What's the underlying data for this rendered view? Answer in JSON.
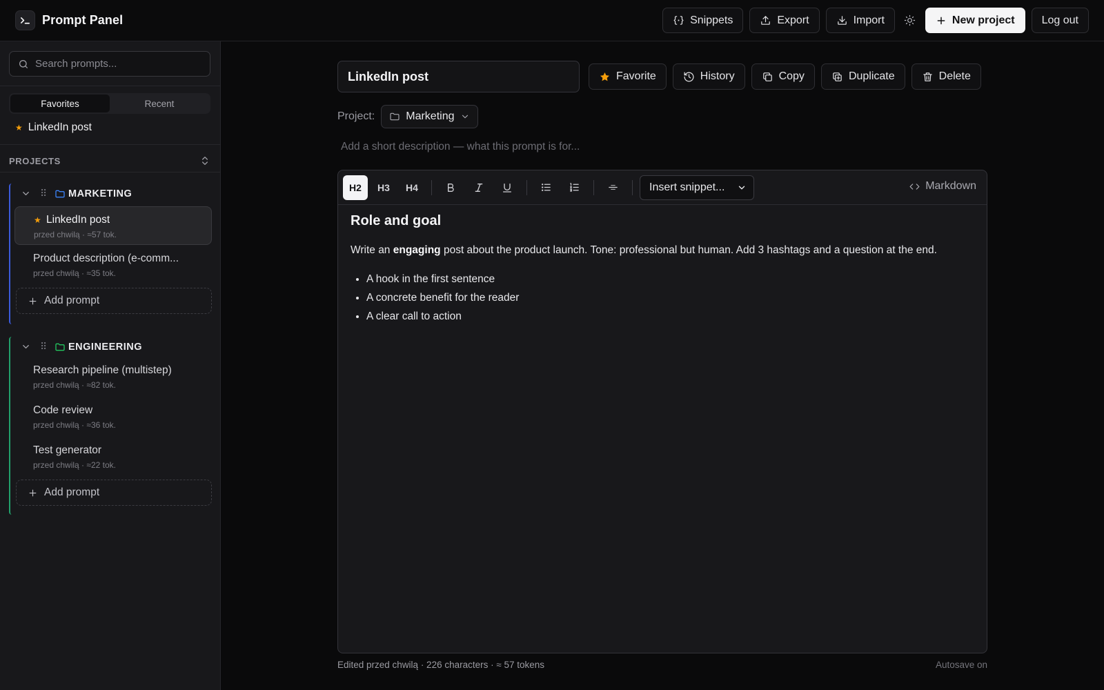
{
  "app": {
    "title": "Prompt Panel"
  },
  "header": {
    "snippets": "Snippets",
    "export": "Export",
    "import": "Import",
    "new_project": "New project",
    "logout": "Log out"
  },
  "sidebar": {
    "search_placeholder": "Search prompts...",
    "tabs": [
      "Favorites",
      "Recent"
    ],
    "active_tab": "Favorites",
    "favorites": [
      {
        "label": "LinkedIn post"
      }
    ],
    "projects_label": "PROJECTS",
    "add_prompt": "Add prompt",
    "projects": [
      {
        "name": "MARKETING",
        "color": "#3b5bdb",
        "items": [
          {
            "title": "LinkedIn post",
            "meta": "przed chwilą · ≈57 tok.",
            "favorite": true,
            "selected": true
          },
          {
            "title": "Product description (e-comm...",
            "meta": "przed chwilą · ≈35 tok.",
            "favorite": false,
            "selected": false
          }
        ]
      },
      {
        "name": "ENGINEERING",
        "color": "#22a06b",
        "items": [
          {
            "title": "Research pipeline (multistep)",
            "meta": "przed chwilą · ≈82 tok."
          },
          {
            "title": "Code review",
            "meta": "przed chwilą · ≈36 tok."
          },
          {
            "title": "Test generator",
            "meta": "przed chwilą · ≈22 tok."
          }
        ]
      }
    ]
  },
  "editor": {
    "title_value": "LinkedIn post",
    "actions": {
      "favorite": "Favorite",
      "history": "History",
      "copy": "Copy",
      "duplicate": "Duplicate",
      "delete": "Delete"
    },
    "project_label": "Project:",
    "project_value": "Marketing",
    "description_placeholder": "Add a short description — what this prompt is for...",
    "toolbar": {
      "h2": "H2",
      "h3": "H3",
      "h4": "H4",
      "active_heading": "H2",
      "snippet_select": "Insert snippet...",
      "markdown": "Markdown"
    },
    "content": {
      "heading": "Role and goal",
      "paragraph_before": "Write an ",
      "paragraph_bold": "engaging",
      "paragraph_after": " post about the product launch. Tone: professional but human. Add 3 hashtags and a question at the end.",
      "bullets": [
        "A hook in the first sentence",
        "A concrete benefit for the reader",
        "A clear call to action"
      ]
    },
    "status": "Edited przed chwilą · 226 characters · ≈ 57 tokens",
    "autosave": "Autosave on"
  },
  "colors": {
    "favorite_star": "#f59e0b",
    "marketing_accent": "#3b5bdb",
    "engineering_accent": "#22a06b"
  },
  "icons": [
    "terminal-icon",
    "snippets-icon",
    "upload-icon",
    "download-icon",
    "sun-icon",
    "plus-icon",
    "search-icon",
    "chevron-up-down-icon",
    "chevron-down-icon",
    "grip-icon",
    "folder-icon",
    "star-icon",
    "history-icon",
    "copy-icon",
    "duplicate-icon",
    "trash-icon",
    "bold-icon",
    "italic-icon",
    "underline-icon",
    "bullet-list-icon",
    "numbered-list-icon",
    "divider-icon",
    "code-icon"
  ]
}
